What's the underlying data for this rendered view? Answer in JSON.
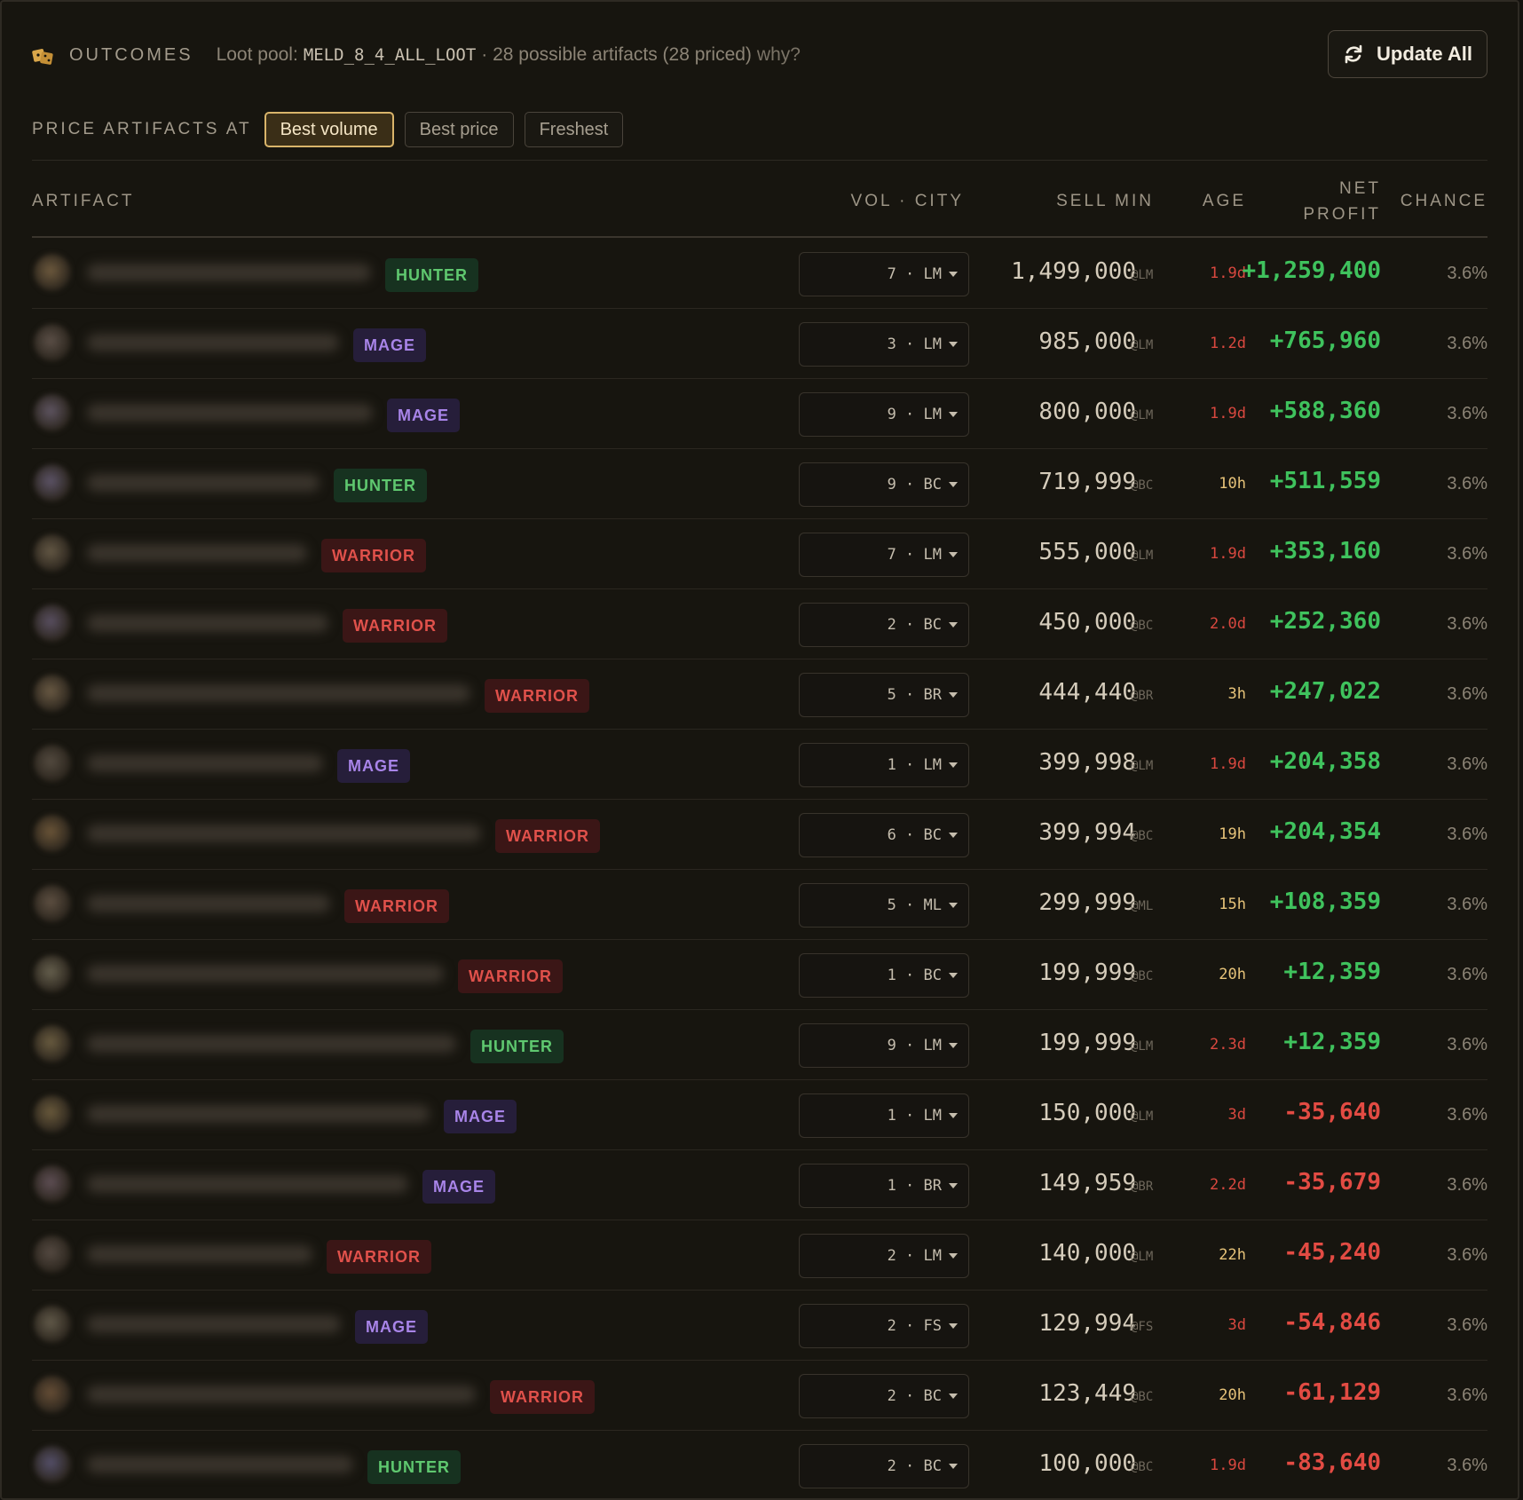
{
  "header": {
    "title": "OUTCOMES",
    "loot_pool_label": "Loot pool:",
    "loot_pool_id": "MELD_8_4_ALL_LOOT",
    "summary": "· 28 possible artifacts (28 priced)",
    "why_link": "why?",
    "update_all": "Update All",
    "icons": {
      "title": "dice-icon",
      "update": "refresh-icon"
    }
  },
  "price_filter": {
    "label": "PRICE ARTIFACTS AT",
    "options": [
      "Best volume",
      "Best price",
      "Freshest"
    ],
    "selected": "Best volume"
  },
  "table": {
    "columns": {
      "artifact": "ARTIFACT",
      "vol_city": "VOL · CITY",
      "sell_min": "SELL MIN",
      "age": "AGE",
      "net_profit_1": "NET",
      "net_profit_2": "PROFIT",
      "chance": "CHANCE"
    },
    "rows": [
      {
        "class": "HUNTER",
        "vol_city": "7 · LM",
        "sell_min": "1,499,000",
        "city": "@LM",
        "age": "1.9d",
        "net_profit": "+1,259,400",
        "chance": "3.6%"
      },
      {
        "class": "MAGE",
        "vol_city": "3 · LM",
        "sell_min": "985,000",
        "city": "@LM",
        "age": "1.2d",
        "net_profit": "+765,960",
        "chance": "3.6%"
      },
      {
        "class": "MAGE",
        "vol_city": "9 · LM",
        "sell_min": "800,000",
        "city": "@LM",
        "age": "1.9d",
        "net_profit": "+588,360",
        "chance": "3.6%"
      },
      {
        "class": "HUNTER",
        "vol_city": "9 · BC",
        "sell_min": "719,999",
        "city": "@BC",
        "age": "10h",
        "net_profit": "+511,559",
        "chance": "3.6%"
      },
      {
        "class": "WARRIOR",
        "vol_city": "7 · LM",
        "sell_min": "555,000",
        "city": "@LM",
        "age": "1.9d",
        "net_profit": "+353,160",
        "chance": "3.6%"
      },
      {
        "class": "WARRIOR",
        "vol_city": "2 · BC",
        "sell_min": "450,000",
        "city": "@BC",
        "age": "2.0d",
        "net_profit": "+252,360",
        "chance": "3.6%"
      },
      {
        "class": "WARRIOR",
        "vol_city": "5 · BR",
        "sell_min": "444,440",
        "city": "@BR",
        "age": "3h",
        "net_profit": "+247,022",
        "chance": "3.6%"
      },
      {
        "class": "MAGE",
        "vol_city": "1 · LM",
        "sell_min": "399,998",
        "city": "@LM",
        "age": "1.9d",
        "net_profit": "+204,358",
        "chance": "3.6%"
      },
      {
        "class": "WARRIOR",
        "vol_city": "6 · BC",
        "sell_min": "399,994",
        "city": "@BC",
        "age": "19h",
        "net_profit": "+204,354",
        "chance": "3.6%"
      },
      {
        "class": "WARRIOR",
        "vol_city": "5 · ML",
        "sell_min": "299,999",
        "city": "@ML",
        "age": "15h",
        "net_profit": "+108,359",
        "chance": "3.6%"
      },
      {
        "class": "WARRIOR",
        "vol_city": "1 · BC",
        "sell_min": "199,999",
        "city": "@BC",
        "age": "20h",
        "net_profit": "+12,359",
        "chance": "3.6%"
      },
      {
        "class": "HUNTER",
        "vol_city": "9 · LM",
        "sell_min": "199,999",
        "city": "@LM",
        "age": "2.3d",
        "net_profit": "+12,359",
        "chance": "3.6%"
      },
      {
        "class": "MAGE",
        "vol_city": "1 · LM",
        "sell_min": "150,000",
        "city": "@LM",
        "age": "3d",
        "net_profit": "-35,640",
        "chance": "3.6%"
      },
      {
        "class": "MAGE",
        "vol_city": "1 · BR",
        "sell_min": "149,959",
        "city": "@BR",
        "age": "2.2d",
        "net_profit": "-35,679",
        "chance": "3.6%"
      },
      {
        "class": "WARRIOR",
        "vol_city": "2 · LM",
        "sell_min": "140,000",
        "city": "@LM",
        "age": "22h",
        "net_profit": "-45,240",
        "chance": "3.6%"
      },
      {
        "class": "MAGE",
        "vol_city": "2 · FS",
        "sell_min": "129,994",
        "city": "@FS",
        "age": "3d",
        "net_profit": "-54,846",
        "chance": "3.6%"
      },
      {
        "class": "WARRIOR",
        "vol_city": "2 · BC",
        "sell_min": "123,449",
        "city": "@BC",
        "age": "20h",
        "net_profit": "-61,129",
        "chance": "3.6%"
      },
      {
        "class": "HUNTER",
        "vol_city": "2 · BC",
        "sell_min": "100,000",
        "city": "@BC",
        "age": "1.9d",
        "net_profit": "-83,640",
        "chance": "3.6%"
      }
    ]
  },
  "colors": {
    "hunter": "#5fc86f",
    "mage": "#a884e8",
    "warrior": "#e0514b",
    "profit_positive": "#3fc25d",
    "profit_negative": "#e24b43",
    "age_stale": "#d9483f",
    "age_fresh": "#e8c47a",
    "accent": "#d9b46a"
  }
}
